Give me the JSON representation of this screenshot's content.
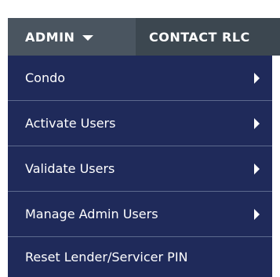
{
  "nav": {
    "tabs": [
      {
        "label": "ADMIN",
        "has_dropdown": true,
        "active": true
      },
      {
        "label": "CONTACT RLC",
        "has_dropdown": false,
        "active": false
      }
    ]
  },
  "menu": {
    "items": [
      {
        "label": "Condo",
        "has_submenu": true
      },
      {
        "label": "Activate Users",
        "has_submenu": true
      },
      {
        "label": "Validate Users",
        "has_submenu": true
      },
      {
        "label": "Manage Admin Users",
        "has_submenu": true
      },
      {
        "label": "Reset Lender/Servicer PIN",
        "has_submenu": false
      }
    ]
  },
  "colors": {
    "menu_background": "#1f2a5a",
    "admin_tab": "#4a5560",
    "contact_tab": "#3c4750",
    "text": "#ffffff"
  }
}
